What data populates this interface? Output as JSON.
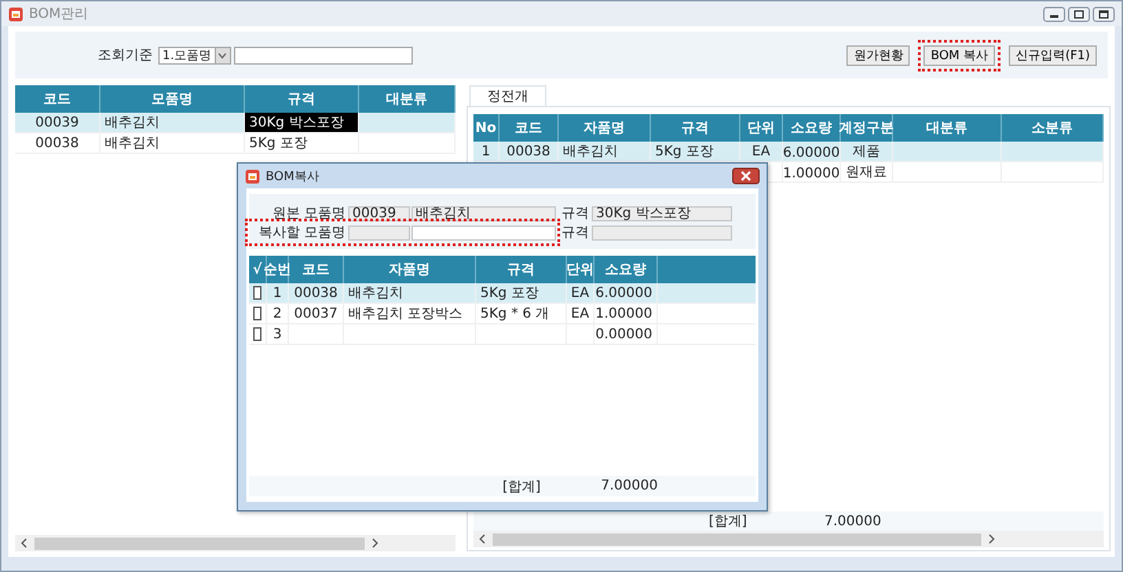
{
  "window": {
    "title": "BOM관리"
  },
  "search": {
    "label": "조회기준",
    "criterion": "1.모품명"
  },
  "toolbar": {
    "buttons": [
      {
        "label": "원가현황",
        "highlighted": false
      },
      {
        "label": "BOM 복사",
        "highlighted": true
      },
      {
        "label": "신규입력(F1)",
        "highlighted": false
      }
    ]
  },
  "parent_table": {
    "columns": [
      "코드",
      "모품명",
      "규격",
      "대분류"
    ],
    "rows": [
      {
        "code": "00039",
        "name": "배추김치",
        "spec": "30Kg 박스포장",
        "selected": true,
        "spec_focused": true
      },
      {
        "code": "00038",
        "name": "배추김치",
        "spec": "5Kg 포장",
        "selected": false,
        "spec_focused": false
      }
    ]
  },
  "tabs": [
    {
      "label": "정전개",
      "selected": true
    }
  ],
  "child_table": {
    "columns": [
      "No",
      "코드",
      "자품명",
      "규격",
      "단위",
      "소요량",
      "계정구분",
      "대분류",
      "소분류"
    ],
    "rows": [
      {
        "no": "1",
        "code": "00038",
        "name": "배추김치",
        "spec": "5Kg 포장",
        "unit": "EA",
        "quantity": "6.00000",
        "account": "제품",
        "selected": true
      },
      {
        "quantity": "1.00000",
        "account": "원재료",
        "selected": false
      }
    ],
    "total_label": "[합계]",
    "total": "7.00000"
  },
  "dialog": {
    "title": "BOM복사",
    "source": {
      "label": "원본 모품명",
      "code": "00039",
      "name": "배추김치",
      "spec_label": "규격",
      "spec": "30Kg 박스포장"
    },
    "target": {
      "label": "복사할 모품명",
      "spec_label": "규격",
      "highlighted": true
    },
    "grid": {
      "columns": [
        "√",
        "순번",
        "코드",
        "자품명",
        "규격",
        "단위",
        "소요량"
      ],
      "rows": [
        {
          "checked": false,
          "seq": "1",
          "code": "00038",
          "name": "배추김치",
          "spec": "5Kg 포장",
          "unit": "EA",
          "quantity": "6.00000",
          "selected": true
        },
        {
          "checked": false,
          "seq": "2",
          "code": "00037",
          "name": "배추김치 포장박스",
          "spec": "5Kg * 6 개",
          "unit": "EA",
          "quantity": "1.00000",
          "selected": false
        },
        {
          "checked": false,
          "seq": "3",
          "quantity": "0.00000",
          "selected": false
        }
      ],
      "total_label": "[합계]",
      "total": "7.00000"
    }
  }
}
